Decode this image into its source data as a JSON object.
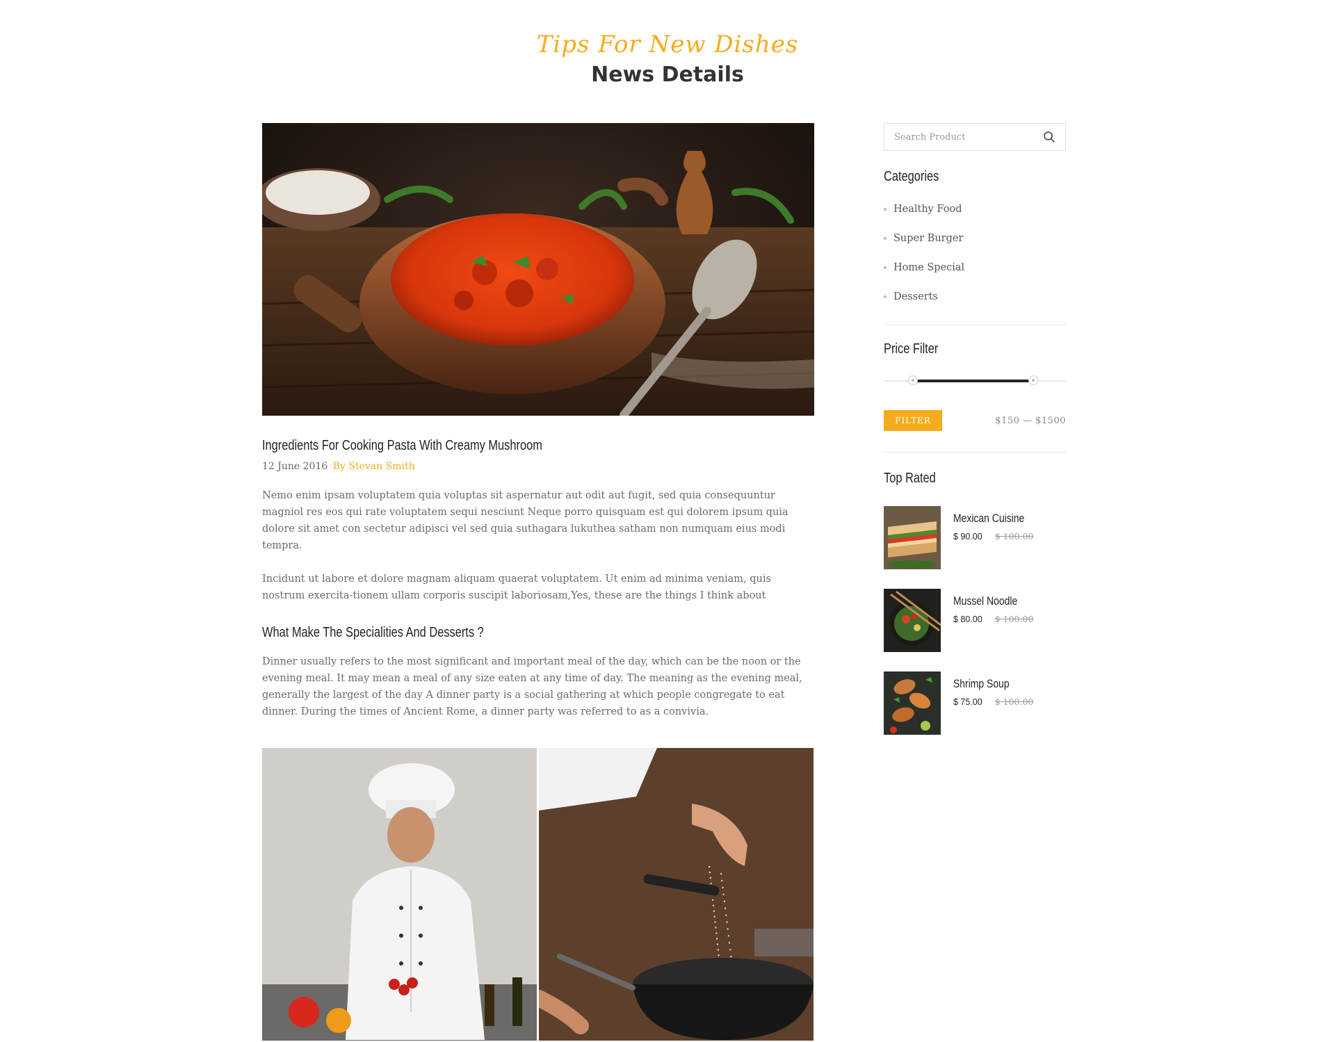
{
  "header": {
    "script_title": "Tips For New Dishes",
    "title": "News Details"
  },
  "post": {
    "title": "Ingredients For Cooking Pasta With Creamy Mushroom",
    "date": "12  June 2016",
    "author": "By Stevan Smith",
    "paragraph1": "Nemo enim ipsam voluptatem quia voluptas sit aspernatur aut odit aut fugit, sed quia consequuntur magniol res eos qui rate voluptatem sequi nesciunt  Neque porro quisquam est qui dolorem ipsum quia dolore sit amet con sectetur adipisci vel sed quia suthagara lukuthea satham non numquam eius modi tempra.",
    "paragraph2": "Incidunt ut labore et dolore magnam aliquam quaerat voluptatem. Ut enim ad minima veniam, quis nostrum exercita-tionem ullam corporis suscipit laboriosam,Yes, these are the things I think about",
    "subheading": "What Make The Specialities And Desserts ?",
    "paragraph3": "Dinner usually refers to the most significant and important meal of the day, which can be the noon or the evening meal. It may mean a meal of any size eaten at any time of day. The meaning as the evening meal, generally the largest of the day A dinner party is a social gathering at which people congregate to eat dinner. During the times of Ancient Rome, a dinner party was referred to as a convivia."
  },
  "sidebar": {
    "search_placeholder": "Search Product",
    "categories_title": "Categories",
    "categories": [
      "Healthy Food",
      "Super Burger",
      "Home Special",
      "Desserts"
    ],
    "price_filter_title": "Price Filter",
    "price_range_fraction": [
      0.16,
      0.82
    ],
    "filter_label": "FILTER",
    "price_range_text": "$150 — $1500",
    "top_rated_title": "Top Rated",
    "products": [
      {
        "name": "Mexican Cuisine",
        "price": "$ 90.00",
        "old_price": "$ 100.00"
      },
      {
        "name": "Mussel Noodle",
        "price": "$ 80.00",
        "old_price": "$ 100.00"
      },
      {
        "name": "Shrimp Soup",
        "price": "$ 75.00",
        "old_price": "$ 100.00"
      }
    ]
  },
  "colors": {
    "accent": "#f4ac1c",
    "heading": "#222222",
    "body_text": "#6a6a6a"
  }
}
